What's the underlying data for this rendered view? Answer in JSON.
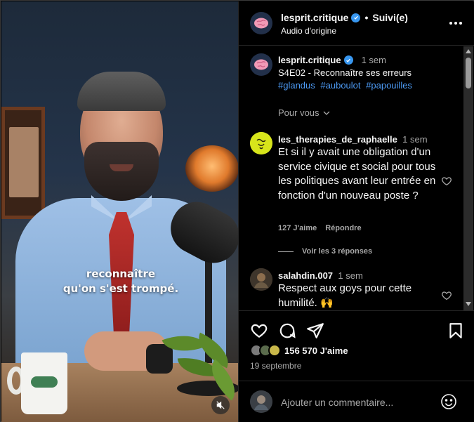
{
  "video": {
    "subtitle_line1": "reconnaître",
    "subtitle_line2": "qu'on s'est trompé."
  },
  "header": {
    "username": "lesprit.critique",
    "separator": "•",
    "follow_label": "Suivi(e)",
    "audio_label": "Audio d'origine"
  },
  "caption": {
    "username": "lesprit.critique",
    "time": "1 sem",
    "title": "S4E02 - Reconnaître ses erreurs",
    "hashtags": [
      "#glandus",
      "#auboulot",
      "#papouilles"
    ],
    "sort_label": "Pour vous"
  },
  "comments": [
    {
      "username": "les_therapies_de_raphaelle",
      "time": "1 sem",
      "text": "Et si il y avait une obligation d'un service civique et social pour tous les politiques avant leur entrée en fonction d'un nouveau poste ?",
      "likes": "127 J'aime",
      "reply_label": "Répondre",
      "view_replies": "Voir les 3 réponses"
    },
    {
      "username": "salahdin.007",
      "time": "1 sem",
      "text": "Respect aux goys pour cette humilité. 🙌"
    }
  ],
  "footer": {
    "likes": "156 570 J'aime",
    "date": "19 septembre",
    "comment_placeholder": "Ajouter un commentaire..."
  },
  "colors": {
    "background": "#000000",
    "text": "#f5f5f5",
    "muted": "#a8a8a8",
    "link": "#4d9bf5",
    "verified": "#3897f0"
  },
  "icons": [
    "brain-icon",
    "verified-icon",
    "more-icon",
    "chevron-down-icon",
    "heart-icon",
    "comment-icon",
    "share-icon",
    "bookmark-icon",
    "emoji-icon",
    "mute-icon"
  ]
}
